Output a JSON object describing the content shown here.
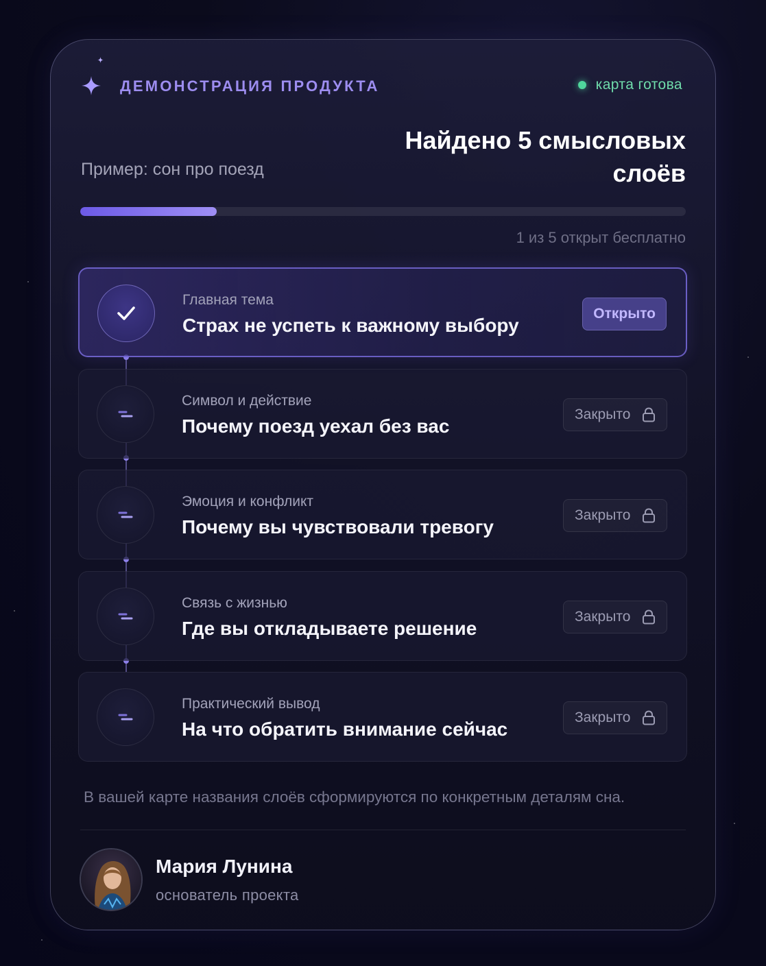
{
  "header": {
    "eyebrow": "ДЕМОНСТРАЦИЯ ПРОДУКТА",
    "status": "карта готова",
    "title": "Найдено 5 смысловых слоёв",
    "subtitle": "Пример: сон про поезд"
  },
  "progress": {
    "value": 0.225,
    "caption": "1 из 5 открыт бесплатно"
  },
  "layers": [
    {
      "label": "Главная тема",
      "title": "Страх не успеть к важному выбору",
      "status": "Открыто",
      "state": "open"
    },
    {
      "label": "Символ и действие",
      "title": "Почему поезд уехал без вас",
      "status": "Закрыто",
      "state": "locked"
    },
    {
      "label": "Эмоция и конфликт",
      "title": "Почему вы чувствовали тревогу",
      "status": "Закрыто",
      "state": "locked"
    },
    {
      "label": "Связь с жизнью",
      "title": "Где вы откладываете решение",
      "status": "Закрыто",
      "state": "locked"
    },
    {
      "label": "Практический вывод",
      "title": "На что обратить внимание сейчас",
      "status": "Закрыто",
      "state": "locked"
    }
  ],
  "footnote": "В вашей карте названия слоёв сформируются по конкретным деталям сна.",
  "author": {
    "name": "Мария Лунина",
    "role": "основатель проекта"
  },
  "icons": {
    "sparkle": "sparkle-icon",
    "check": "check-icon",
    "pending": "pending-icon",
    "lock": "lock-icon"
  },
  "colors": {
    "accent": "#8c7fe8",
    "status_ok": "#4fd69c",
    "background": "#0b0b1c"
  }
}
